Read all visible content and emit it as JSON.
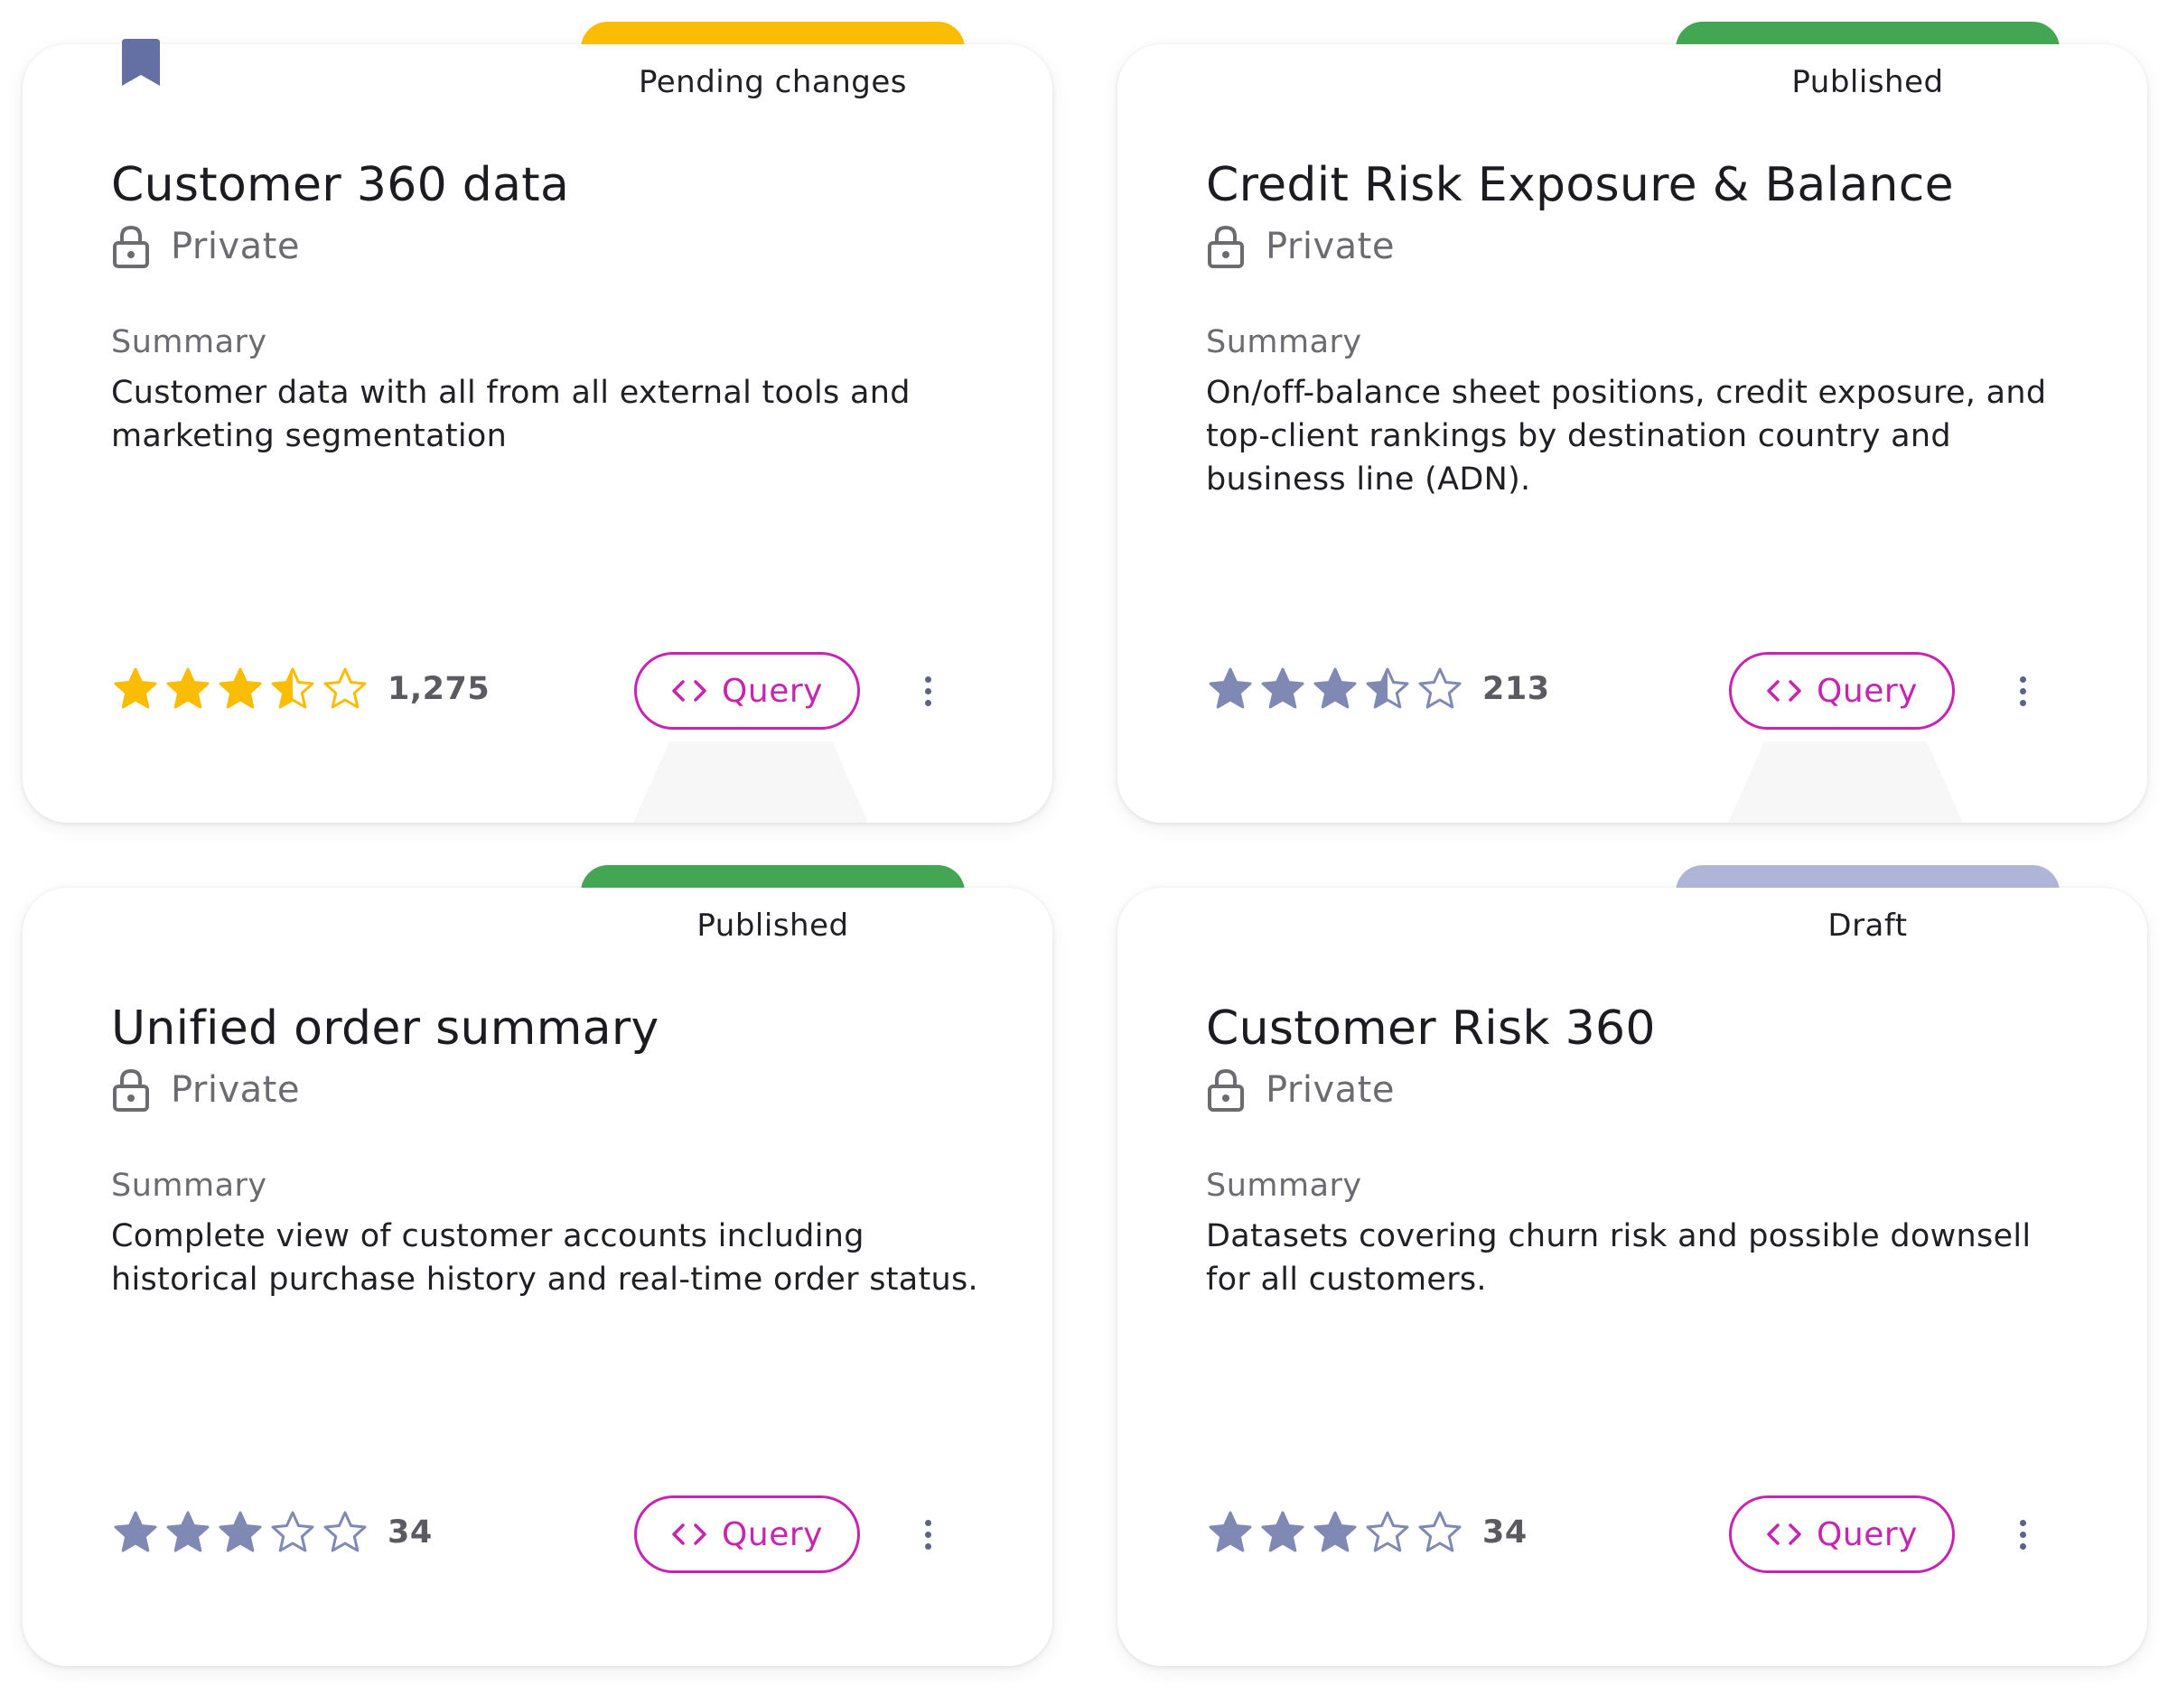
{
  "query_label": "Query",
  "cards": [
    {
      "status": "Pending changes",
      "status_color": "#fbbc04",
      "bookmarked": true,
      "title": "Customer 360 data",
      "visibility": "Private",
      "summary_label": "Summary",
      "summary": "Customer data with all from all external tools and marketing segmentation",
      "rating": 3.5,
      "rating_count": "1,275",
      "star_color": "#fbbc04"
    },
    {
      "status": "Published",
      "status_color": "#43a653",
      "bookmarked": false,
      "title": "Credit Risk Exposure & Balance",
      "visibility": "Private",
      "summary_label": "Summary",
      "summary": "On/off-balance sheet positions, credit exposure, and top-client rankings by destination country and business line (ADN).",
      "rating": 3.5,
      "rating_count": "213",
      "star_color": "#8088b4"
    },
    {
      "status": "Published",
      "status_color": "#43a653",
      "bookmarked": false,
      "title": "Unified order summary",
      "visibility": "Private",
      "summary_label": "Summary",
      "summary": "Complete view of customer accounts including historical purchase history and real-time order status.",
      "rating": 3,
      "rating_count": "34",
      "star_color": "#8088b4"
    },
    {
      "status": "Draft",
      "status_color": "#aeb5d6",
      "bookmarked": false,
      "title": "Customer Risk 360",
      "visibility": "Private",
      "summary_label": "Summary",
      "summary": "Datasets covering churn risk and possible downsell for all customers.",
      "rating": 3,
      "rating_count": "34",
      "star_color": "#8088b4"
    }
  ],
  "icons": {
    "bookmark": "bookmark-icon",
    "visibility": "lock-icon",
    "query": "code-icon",
    "more": "more-vert-icon",
    "rating": "star-icon"
  },
  "colors": {
    "query_accent": "#c724b1",
    "bookmark": "#6470a4",
    "more_dots": "#5c6486"
  }
}
